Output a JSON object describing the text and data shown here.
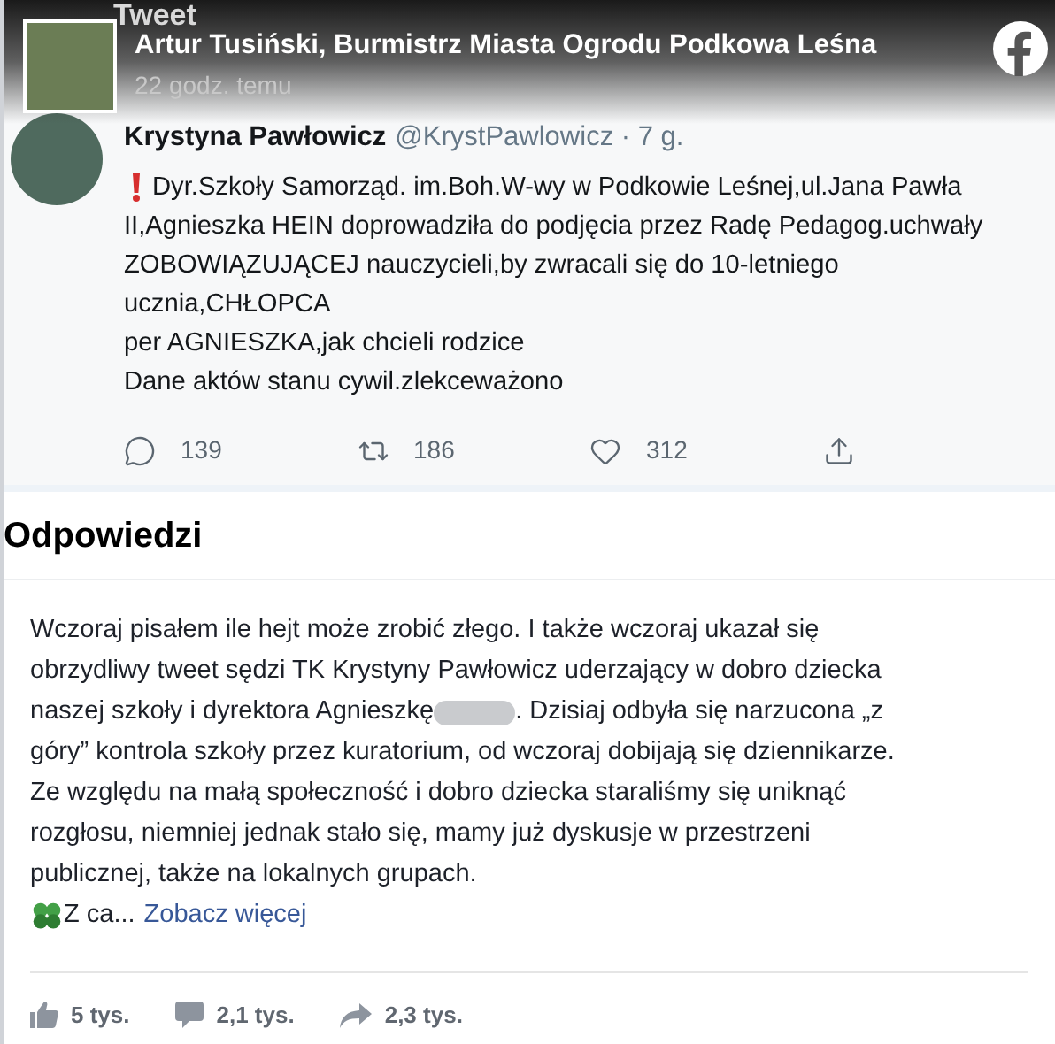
{
  "post_header": {
    "author": "Artur Tusiński, Burmistrz Miasta Ogrodu Podkowa Leśna",
    "time": "22 godz. temu"
  },
  "tweet": {
    "heading": "Tweet",
    "author": "Krystyna Pawłowicz",
    "handle": "@KrystPawlowicz · 7 g.",
    "lines": [
      "Dyr.Szkoły Samorząd. im.Boh.W-wy w Podkowie Leśnej,ul.Jana Pawła",
      "II,Agnieszka HEIN doprowadziła do podjęcia przez Radę Pedagog.uchwały",
      "ZOBOWIĄZUJĄCEJ nauczycieli,by zwracali się do 10-letniego",
      "ucznia,CHŁOPCA",
      "per AGNIESZKA,jak chcieli rodzice",
      "Dane aktów stanu cywil.zlekceważono"
    ],
    "actions": [
      {
        "kind": "reply",
        "count": "139"
      },
      {
        "kind": "retweet",
        "count": "186"
      },
      {
        "kind": "like",
        "count": "312"
      },
      {
        "kind": "share"
      }
    ]
  },
  "replies_heading": "Odpowiedzi",
  "post": {
    "lines": [
      [
        "Wczoraj pisałem ile hejt może zrobić złego. I także wczoraj ukazał się"
      ],
      [
        "obrzydliwy tweet sędzi TK Krystyny Pawłowicz uderzający w dobro dziecka"
      ],
      [
        "naszej szkoły i dyrektora Agnieszkę",
        ". Dzisiaj odbyła się narzucona „z"
      ],
      [
        "góry” kontrola szkoły przez kuratorium, od wczoraj dobijają się dziennikarze."
      ],
      [
        "Ze względu na małą społeczność i dobro dziecka staraliśmy się uniknąć"
      ],
      [
        "rozgłosu, niemniej jednak stało się, mamy już dyskusje w przestrzeni"
      ],
      [
        "publicznej, także na lokalnych grupach."
      ]
    ],
    "teaser": "Z ca...",
    "more_link": "Zobacz więcej"
  },
  "stats": [
    {
      "kind": "likes",
      "count": "5 tys."
    },
    {
      "kind": "comments",
      "count": "2,1 tys."
    },
    {
      "kind": "shares",
      "count": "2,3 tys."
    }
  ]
}
